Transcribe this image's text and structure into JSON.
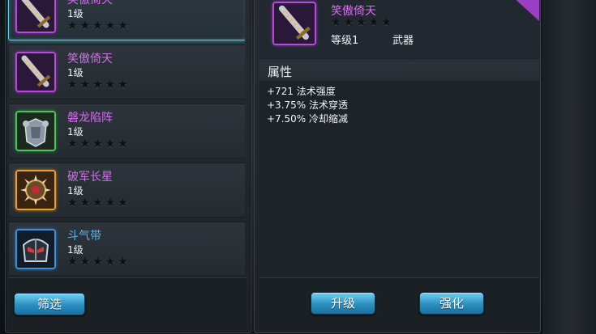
{
  "items": [
    {
      "name": "笑傲倚天",
      "level": "1级",
      "stars": "★★★★★",
      "frame": "purple",
      "icon": "sword-icon",
      "selected": true
    },
    {
      "name": "笑傲倚天",
      "level": "1级",
      "stars": "★★★★★",
      "frame": "purple",
      "icon": "sword-icon",
      "selected": false
    },
    {
      "name": "磐龙陷阵",
      "level": "1级",
      "stars": "★★★★★",
      "frame": "green",
      "icon": "armor-icon",
      "selected": false
    },
    {
      "name": "破军长星",
      "level": "1级",
      "stars": "★★★★★",
      "frame": "orange",
      "icon": "spiked-orb-icon",
      "selected": false
    },
    {
      "name": "斗气带",
      "level": "1级",
      "stars": "★★★★★",
      "frame": "blue",
      "icon": "helmet-icon",
      "selected": false
    }
  ],
  "filter_button": "筛选",
  "detail": {
    "name": "笑傲倚天",
    "stars": "★★★★★",
    "level": "等级1",
    "type": "武器",
    "attr_title": "属性",
    "attributes": [
      "+721 法术强度",
      "+3.75% 法术穿透",
      "+7.50% 冷却缩减"
    ]
  },
  "upgrade_button": "升级",
  "enhance_button": "强化",
  "colors": {
    "accent": "#4fd2e3",
    "epic": "#d56ef0",
    "button": "#2b8fc2"
  }
}
